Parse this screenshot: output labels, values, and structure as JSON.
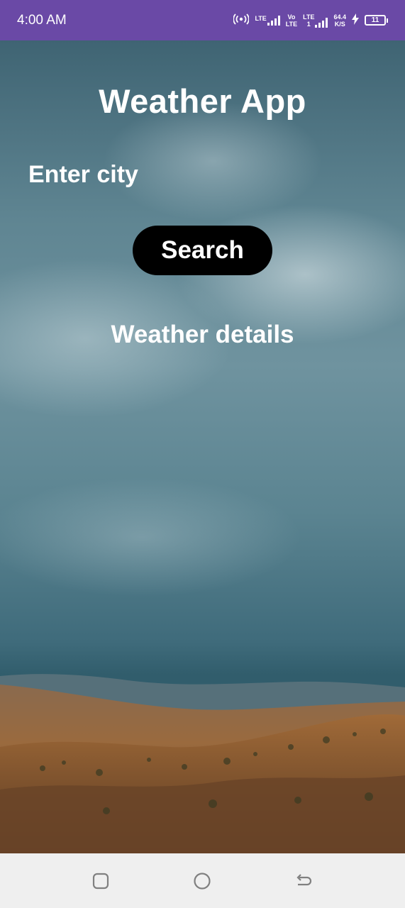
{
  "status_bar": {
    "time": "4:00 AM",
    "network_1": "LTE",
    "network_2_top": "Vo",
    "network_2_bottom": "LTE",
    "network_3": "LTE",
    "network_3_sub": "1",
    "speed_value": "64.4",
    "speed_unit": "K/S",
    "battery_level": "11",
    "icons": [
      "hotspot-icon",
      "signal-icon",
      "signal-icon",
      "charging-icon",
      "battery-icon"
    ]
  },
  "app": {
    "title": "Weather App",
    "city_input": {
      "placeholder": "Enter city",
      "value": ""
    },
    "search_label": "Search",
    "details_text": "Weather details"
  },
  "nav_bar": {
    "icons": [
      "recents-icon",
      "home-icon",
      "back-icon"
    ]
  },
  "colors": {
    "status_bar": "#6a49a6",
    "button": "#000000",
    "text": "#ffffff",
    "nav_bar": "#efefef"
  }
}
